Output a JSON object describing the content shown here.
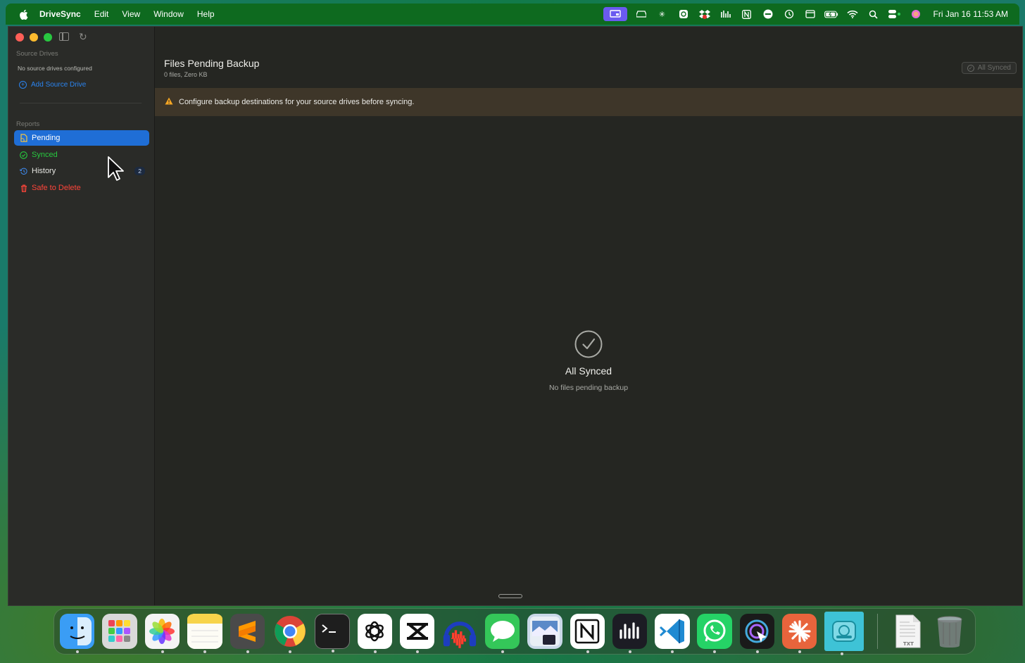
{
  "menubar": {
    "app_name": "DriveSync",
    "menus": [
      "Edit",
      "View",
      "Window",
      "Help"
    ],
    "clock": "Fri Jan 16  11:53 AM",
    "tray_icons": [
      "screen-mirror-icon",
      "drive-icon",
      "asterisk-icon",
      "chatgpt-icon",
      "dropbox-icon",
      "audio-bars-icon",
      "notion-icon",
      "stop-icon",
      "time-machine-icon",
      "display-icon",
      "battery-icon",
      "wifi-icon",
      "search-icon",
      "control-center-icon",
      "siri-icon"
    ]
  },
  "sidebar": {
    "source_drives_title": "Source Drives",
    "no_drives_text": "No source drives configured",
    "add_drive_label": "Add Source Drive",
    "reports_title": "Reports",
    "items": [
      {
        "label": "Pending",
        "icon": "pending-icon",
        "color": "#ffffff"
      },
      {
        "label": "Synced",
        "icon": "check-circle-icon",
        "color": "#27c93f"
      },
      {
        "label": "History",
        "icon": "history-icon",
        "color": "#e6e6e2",
        "badge": "2"
      },
      {
        "label": "Safe to Delete",
        "icon": "trash-icon",
        "color": "#ff453a"
      }
    ]
  },
  "main": {
    "title": "Files Pending Backup",
    "subtitle": "0 files, Zero KB",
    "status_button": "All Synced",
    "warning": "Configure backup destinations for your source drives before syncing.",
    "empty_title": "All Synced",
    "empty_subtitle": "No files pending backup"
  },
  "dock": {
    "apps": [
      {
        "name": "finder",
        "label": "Finder",
        "color": "#3a9df5"
      },
      {
        "name": "launchpad",
        "label": "Launchpad",
        "color": "#d9d9d9"
      },
      {
        "name": "photos",
        "label": "Photos",
        "color": "#f4f4f4"
      },
      {
        "name": "notes",
        "label": "Notes",
        "color": "#f7d44a"
      },
      {
        "name": "sublime",
        "label": "Sublime Text",
        "color": "#4a4a4a"
      },
      {
        "name": "chrome",
        "label": "Chrome",
        "color": "#ffffff"
      },
      {
        "name": "terminal",
        "label": "Terminal",
        "color": "#1e1e1e"
      },
      {
        "name": "chatgpt",
        "label": "ChatGPT",
        "color": "#ffffff"
      },
      {
        "name": "capcut",
        "label": "CapCut",
        "color": "#ffffff"
      },
      {
        "name": "audacity",
        "label": "Audacity",
        "color": "#1d3dbf"
      },
      {
        "name": "messages",
        "label": "Messages",
        "color": "#34c759"
      },
      {
        "name": "preview",
        "label": "Preview",
        "color": "#c9d8e8"
      },
      {
        "name": "notion",
        "label": "Notion",
        "color": "#ffffff"
      },
      {
        "name": "voice-memos",
        "label": "Voice Memos",
        "color": "#1c1c24"
      },
      {
        "name": "vscode",
        "label": "VS Code",
        "color": "#ffffff"
      },
      {
        "name": "whatsapp",
        "label": "WhatsApp",
        "color": "#25d366"
      },
      {
        "name": "screen-studio",
        "label": "Screen Studio",
        "color": "#1a1a1a"
      },
      {
        "name": "claude",
        "label": "Claude",
        "color": "#e8643c"
      },
      {
        "name": "drivesync",
        "label": "DriveSync",
        "color": "#3ec3d6"
      }
    ],
    "file_label": "TXT"
  }
}
